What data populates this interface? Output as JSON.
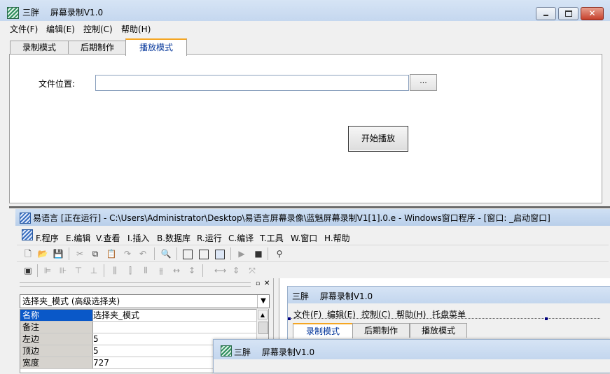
{
  "main_window": {
    "app_name": "三胖",
    "title": "屏幕录制V1.0",
    "menu": [
      "文件(F)",
      "编辑(E)",
      "控制(C)",
      "帮助(H)"
    ],
    "tabs": [
      "录制模式",
      "后期制作",
      "播放模式"
    ],
    "active_tab": "播放模式",
    "file_label": "文件位置:",
    "file_value": "",
    "browse_label": "...",
    "play_button": "开始播放"
  },
  "ide_window": {
    "title": "易语言 [正在运行] - C:\\Users\\Administrator\\Desktop\\易语言屏幕录像\\蓝魅屏幕录制V1[1].0.e - Windows窗口程序 - [窗口: _启动窗口]",
    "menu": [
      "F.程序",
      "E.编辑",
      "V.查看",
      "I.插入",
      "B.数据库",
      "R.运行",
      "C.编译",
      "T.工具",
      "W.窗口",
      "H.帮助"
    ],
    "combo_value": "选择夹_模式 (高级选择夹)",
    "properties": [
      {
        "name": "名称",
        "value": "选择夹_模式"
      },
      {
        "name": "备注",
        "value": ""
      },
      {
        "name": "左边",
        "value": "5"
      },
      {
        "name": "顶边",
        "value": "5"
      },
      {
        "name": "宽度",
        "value": "727"
      }
    ],
    "preview": {
      "app_name": "三胖",
      "title": "屏幕录制V1.0",
      "menu": [
        "文件(F)",
        "编辑(E)",
        "控制(C)",
        "帮助(H)",
        "托盘菜单"
      ],
      "tabs": [
        "录制模式",
        "后期制作",
        "播放模式"
      ]
    }
  },
  "floating_window": {
    "app_name": "三胖",
    "title": "屏幕录制V1.0"
  }
}
